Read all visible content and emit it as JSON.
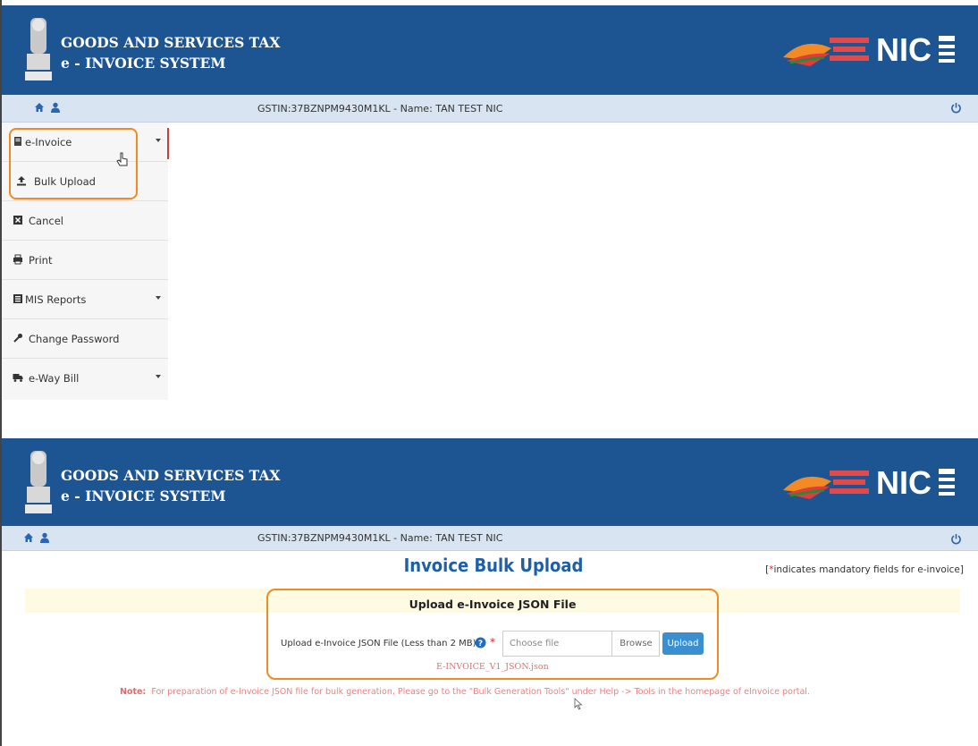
{
  "header": {
    "title_line1": "GOODS AND SERVICES TAX",
    "title_line2": "e - INVOICE SYSTEM",
    "emblem_icon": "emblem-icon",
    "logos": [
      "azadi-ka-amrit-mahotsav-logo",
      "nic-logo"
    ]
  },
  "topbar": {
    "gstin_text": "GSTIN:37BZNPM9430M1KL - Name: TAN TEST NIC",
    "icons": [
      "home-icon",
      "user-icon",
      "power-icon"
    ]
  },
  "sidebar": {
    "items": [
      {
        "label": "e-Invoice",
        "icon": "document-icon",
        "has_caret": true
      },
      {
        "label": "Bulk Upload",
        "icon": "upload-icon",
        "has_caret": false
      },
      {
        "label": "Cancel",
        "icon": "cancel-icon",
        "has_caret": false
      },
      {
        "label": "Print",
        "icon": "print-icon",
        "has_caret": false
      },
      {
        "label": "MIS Reports",
        "icon": "report-icon",
        "has_caret": true
      },
      {
        "label": "Change Password",
        "icon": "key-icon",
        "has_caret": false
      },
      {
        "label": "e-Way Bill",
        "icon": "truck-icon",
        "has_caret": true
      }
    ]
  },
  "bulk_upload": {
    "page_title": "Invoice Bulk Upload",
    "mandatory_prefix": "[",
    "mandatory_star": "*",
    "mandatory_text": "indicates mandatory fields for e-invoice]",
    "section_title": "Upload e-Invoice JSON File",
    "field_label": "Upload e-Invoice JSON File (Less than 2 MB):",
    "file_placeholder": "Choose file",
    "browse_label": "Browse",
    "upload_label": "Upload",
    "sample_link": "E-INVOICE_V1_JSON.json",
    "note_label": "Note:",
    "note_text": "For preparation of e-Invoice JSON file for bulk generation, Please go to the \"Bulk Generation Tools\" under Help -> Tools in the homepage of eInvoice portal."
  },
  "colors": {
    "header_bg": "#1d5592",
    "topbar_bg": "#d8e4f1",
    "highlight": "#f08a24",
    "title_blue": "#1d5fa9",
    "note_red": "#ef8080"
  }
}
